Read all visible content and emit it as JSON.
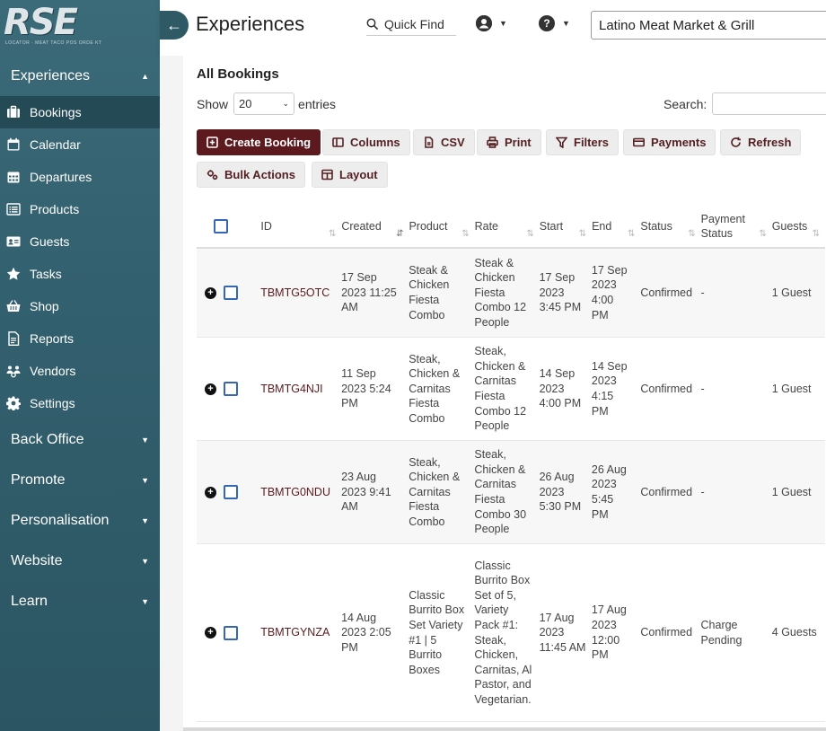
{
  "logo": {
    "text": "RSE",
    "sub": "LOCATOR  · MEAT TACO POS ORDE KT"
  },
  "sidebar": {
    "sections": [
      {
        "label": "Experiences",
        "caret": "▲"
      },
      {
        "label": "Back Office",
        "caret": "▼"
      },
      {
        "label": "Promote",
        "caret": "▼"
      },
      {
        "label": "Personalisation",
        "caret": "▼"
      },
      {
        "label": "Website",
        "caret": "▼"
      },
      {
        "label": "Learn",
        "caret": "▼"
      }
    ],
    "items": [
      {
        "label": "Bookings",
        "icon": "briefcase-icon"
      },
      {
        "label": "Calendar",
        "icon": "calendar-icon"
      },
      {
        "label": "Departures",
        "icon": "calendar-grid-icon"
      },
      {
        "label": "Products",
        "icon": "list-icon"
      },
      {
        "label": "Guests",
        "icon": "id-card-icon"
      },
      {
        "label": "Tasks",
        "icon": "star-icon"
      },
      {
        "label": "Shop",
        "icon": "basket-icon"
      },
      {
        "label": "Reports",
        "icon": "report-icon"
      },
      {
        "label": "Vendors",
        "icon": "users-gear-icon"
      },
      {
        "label": "Settings",
        "icon": "gear-icon"
      }
    ]
  },
  "header": {
    "back": "←",
    "title": "Experiences",
    "quick_find": "Quick Find",
    "user_dd": "▼",
    "help_dd": "▼",
    "help_glyph": "?",
    "business": "Latino Meat Market & Grill"
  },
  "main": {
    "title": "All Bookings",
    "show_label": "Show",
    "show_value": "20",
    "entries_label": "entries",
    "search_label": "Search:",
    "buttons": {
      "create": "Create Booking",
      "columns": "Columns",
      "csv": "CSV",
      "print": "Print",
      "filters": "Filters",
      "payments": "Payments",
      "refresh": "Refresh",
      "bulk": "Bulk Actions",
      "layout": "Layout"
    }
  },
  "table": {
    "headers": [
      "ID",
      "Created",
      "Product",
      "Rate",
      "Start",
      "End",
      "Status",
      "Payment Status",
      "Guests"
    ],
    "rows": [
      {
        "id": "TBMTG5OTC",
        "created": "17 Sep 2023 11:25 AM",
        "product": "Steak & Chicken Fiesta Combo",
        "rate": "Steak & Chicken Fiesta Combo 12 People",
        "start": "17 Sep 2023 3:45 PM",
        "end": "17 Sep 2023 4:00 PM",
        "status": "Confirmed",
        "payment": "-",
        "guests": "1 Guest"
      },
      {
        "id": "TBMTG4NJI",
        "created": "11 Sep 2023 5:24 PM",
        "product": "Steak, Chicken & Carnitas Fiesta Combo",
        "rate": "Steak, Chicken & Carnitas Fiesta Combo 12 People",
        "start": "14 Sep 2023 4:00 PM",
        "end": "14 Sep 2023 4:15 PM",
        "status": "Confirmed",
        "payment": "-",
        "guests": "1 Guest"
      },
      {
        "id": "TBMTG0NDU",
        "created": "23 Aug 2023 9:41 AM",
        "product": "Steak, Chicken & Carnitas Fiesta Combo",
        "rate": "Steak, Chicken & Carnitas Fiesta Combo 30 People",
        "start": "26 Aug 2023 5:30 PM",
        "end": "26 Aug 2023 5:45 PM",
        "status": "Confirmed",
        "payment": "-",
        "guests": "1 Guest"
      },
      {
        "id": "TBMTGYNZA",
        "created": "14 Aug 2023 2:05 PM",
        "product": "Classic Burrito Box Set Variety #1 | 5 Burrito Boxes",
        "rate": "Classic Burrito Box Set of 5, Variety Pack #1: Steak, Chicken, Carnitas, Al Pastor, and Vegetarian.",
        "start": "17 Aug 2023 11:45 AM",
        "end": "17 Aug 2023 12:00 PM",
        "status": "Confirmed",
        "payment": "Charge Pending",
        "guests": "4 Guests"
      }
    ]
  }
}
